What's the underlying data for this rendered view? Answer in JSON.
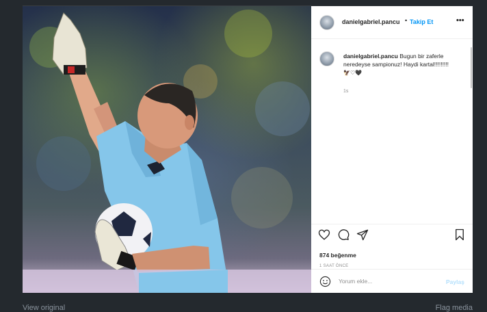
{
  "post": {
    "username": "danielgabriel.pancu",
    "separator": "•",
    "follow_label": "Takip Et",
    "more_label": "•••",
    "caption_user": "danielgabriel.pancu",
    "caption_text": "Bugun bir zaferle neredeyse sampionuz! Haydi kartal!!!!!!!!!",
    "caption_emojis": "🦅♡🖤",
    "comment_age": "1s",
    "likes": "874 beğenme",
    "posted_time": "1 SAAT ÖNCE",
    "comment_placeholder": "Yorum ekle...",
    "post_button": "Paylaş"
  },
  "footer": {
    "view_original": "View original",
    "flag_media": "Flag media"
  },
  "icons": {
    "like": "heart-icon",
    "comment": "comment-icon",
    "share": "paper-plane-icon",
    "save": "bookmark-icon",
    "emoji": "smiley-icon"
  },
  "colors": {
    "accent": "#0095f6",
    "post_button_disabled": "#b2dffc",
    "page_background": "#24292e"
  }
}
